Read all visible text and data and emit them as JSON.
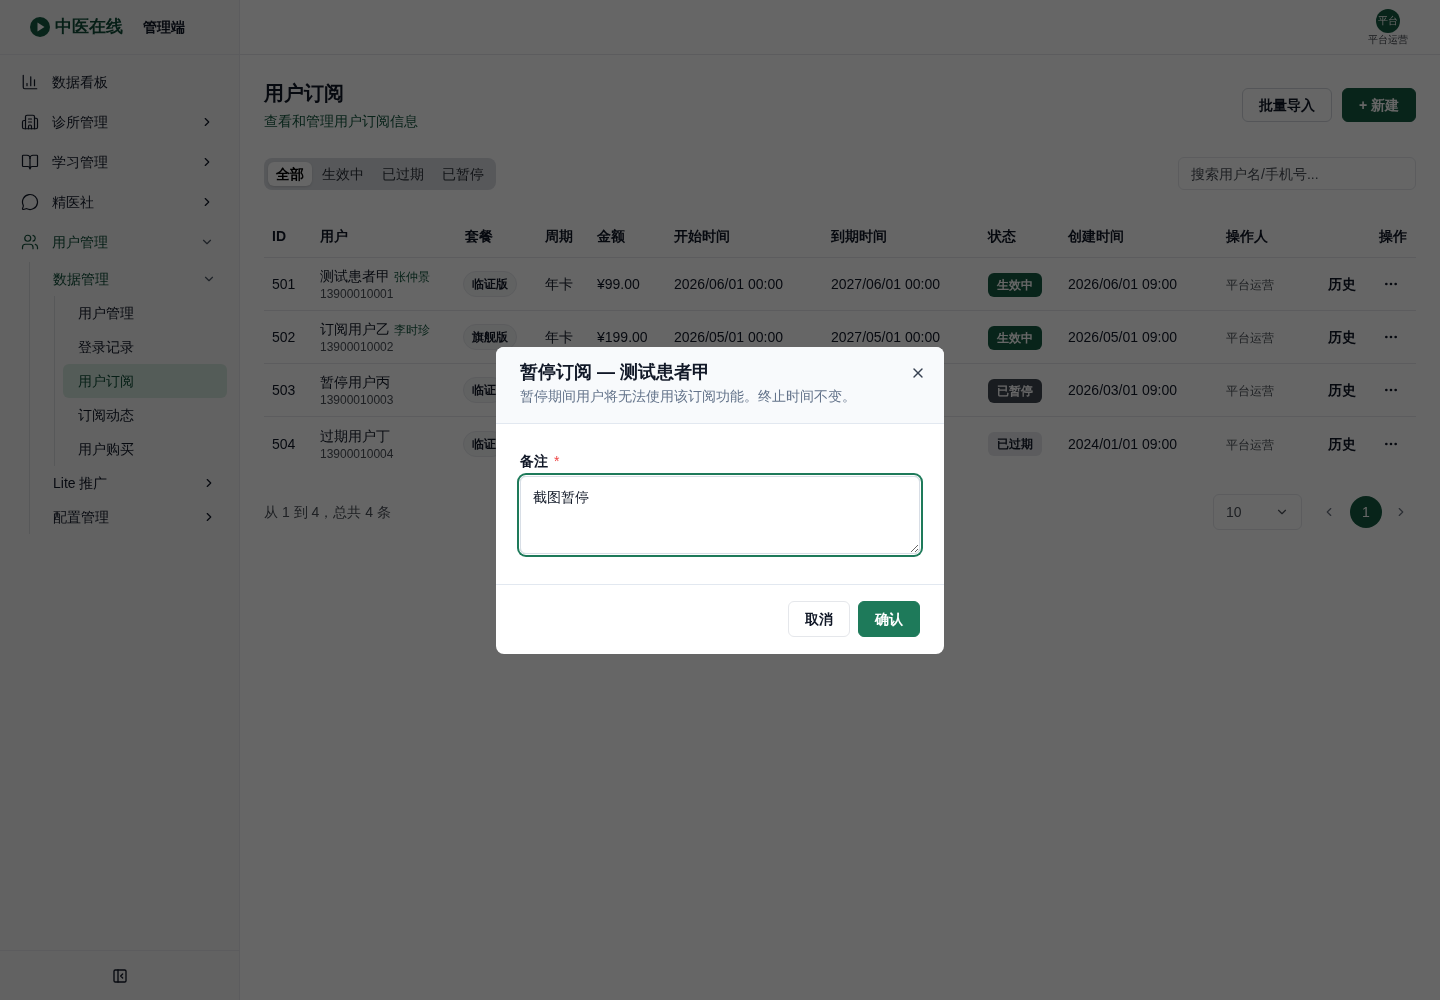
{
  "sidebar": {
    "brand": {
      "name": "中医在线",
      "tag": "管理端"
    },
    "items": [
      {
        "label": "数据看板",
        "selected": false
      },
      {
        "label": "诊所管理",
        "selected": false,
        "expanded": false
      },
      {
        "label": "学习管理",
        "selected": false,
        "expanded": false
      },
      {
        "label": "精医社",
        "selected": false,
        "expanded": false
      },
      {
        "label": "用户管理",
        "selected": false,
        "expanded": true,
        "children": [
          {
            "label": "数据管理",
            "selected": false,
            "expanded": true,
            "children": [
              {
                "label": "用户管理",
                "selected": false
              },
              {
                "label": "登录记录",
                "selected": false
              },
              {
                "label": "用户订阅",
                "selected": true
              },
              {
                "label": "订阅动态",
                "selected": false
              },
              {
                "label": "用户购买",
                "selected": false
              }
            ]
          },
          {
            "label": "Lite 推广",
            "selected": false,
            "expanded": false
          },
          {
            "label": "配置管理",
            "selected": false,
            "expanded": false
          }
        ]
      }
    ]
  },
  "top_bar": {
    "user": {
      "avatar_text": "平台",
      "name": "平台运营"
    }
  },
  "page": {
    "title": "用户订阅",
    "subtitle": "查看和管理用户订阅信息",
    "actions": [
      {
        "label": "批量导入",
        "kind": "secondary"
      },
      {
        "label": "+ 新建",
        "kind": "primary"
      }
    ]
  },
  "filter_tabs": [
    {
      "label": "全部",
      "selected": true
    },
    {
      "label": "生效中",
      "selected": false
    },
    {
      "label": "已过期",
      "selected": false
    },
    {
      "label": "已暂停",
      "selected": false
    }
  ],
  "search": {
    "placeholder": "搜索用户名/手机号..."
  },
  "table": {
    "columns": [
      "ID",
      "用户",
      "套餐",
      "周期",
      "金额",
      "开始时间",
      "到期时间",
      "状态",
      "创建时间",
      "操作人",
      "操作"
    ],
    "rows": [
      {
        "id": "501",
        "user": {
          "name": "测试患者甲",
          "doctor": "张仲景",
          "phone": "13900010001"
        },
        "plan": "临证版",
        "period": "年卡",
        "amount": "¥99.00",
        "start": "2026/06/01 00:00",
        "end": "2027/06/01 00:00",
        "status": {
          "label": "生效中",
          "kind": "active"
        },
        "created": "2026/06/01 09:00",
        "operator": "平台运营",
        "history": "历史"
      },
      {
        "id": "502",
        "user": {
          "name": "订阅用户乙",
          "doctor": "李时珍",
          "phone": "13900010002"
        },
        "plan": "旗舰版",
        "period": "年卡",
        "amount": "¥199.00",
        "start": "2026/05/01 00:00",
        "end": "2027/05/01 00:00",
        "status": {
          "label": "生效中",
          "kind": "active"
        },
        "created": "2026/05/01 09:00",
        "operator": "平台运营",
        "history": "历史"
      },
      {
        "id": "503",
        "user": {
          "name": "暂停用户丙",
          "phone": "13900010003"
        },
        "plan": "临证",
        "status": {
          "label": "已暂停",
          "kind": "paused"
        },
        "created": "2026/03/01 09:00",
        "operator": "平台运营",
        "history": "历史"
      },
      {
        "id": "504",
        "user": {
          "name": "过期用户丁",
          "phone": "13900010004"
        },
        "plan": "临证",
        "status": {
          "label": "已过期",
          "kind": "expired"
        },
        "created": "2024/01/01 09:00",
        "operator": "平台运营",
        "history": "历史"
      }
    ]
  },
  "pagination": {
    "summary": "从 1 到 4，总共 4 条",
    "page_size": "10",
    "pages": [
      {
        "label": "1",
        "selected": true
      }
    ]
  },
  "dialog": {
    "title": "暂停订阅 — 测试患者甲",
    "description": "暂停期间用户将无法使用该订阅功能。终止时间不变。",
    "field": {
      "label": "备注",
      "required_mark": "*",
      "value": "截图暂停"
    },
    "buttons": [
      {
        "label": "取消",
        "kind": "secondary"
      },
      {
        "label": "确认",
        "kind": "primary"
      }
    ]
  }
}
